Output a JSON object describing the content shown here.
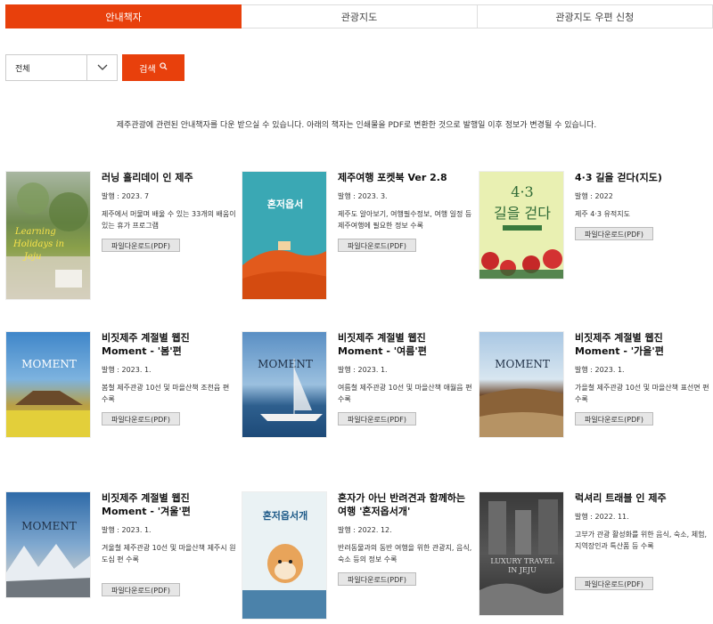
{
  "tabs": [
    {
      "label": "안내책자",
      "active": true
    },
    {
      "label": "관광지도",
      "active": false
    },
    {
      "label": "관광지도 우편 신청",
      "active": false
    }
  ],
  "filter": {
    "select_value": "전체",
    "search_label": "검색"
  },
  "notice": "제주관광에 관련된 안내책자를 다운 받으실 수 있습니다. 아래의 책자는 인쇄물을 PDF로 변환한 것으로 발행일 이후 정보가 변경될 수 있습니다.",
  "download_label": "파일다운로드(PDF)",
  "books": [
    {
      "title": "러닝 홀리데이 인 제주",
      "date": "발행 : 2023. 7",
      "desc": "제주에서 머물며 배울 수 있는 33개의 배움이 있는 휴가 프로그램",
      "cover_text": "Learning Holidays in Jeju"
    },
    {
      "title": "제주여행 포켓북 Ver 2.8",
      "date": "발행 : 2023. 3.",
      "desc": "제주도 알아보기, 여행필수정보, 여행 일정 등 제주여행에 필요한 정보 수록",
      "cover_text": "혼저옵서"
    },
    {
      "title": "4·3 길을 걷다(지도)",
      "date": "발행 : 2022",
      "desc": "제주 4·3 유적지도",
      "cover_text": "4·3 길을 걷다"
    },
    {
      "title": "비짓제주 계절별 웹진 Moment - '봄'편",
      "date": "발행 : 2023. 1.",
      "desc": "봄철 제주관광 10선 및 마을산책 조천읍 편 수록",
      "cover_text": "MOMENT"
    },
    {
      "title": "비짓제주 계절별 웹진 Moment - '여름'편",
      "date": "발행 : 2023. 1.",
      "desc": "여름철 제주관광 10선 및 마을산책 애월읍 편 수록",
      "cover_text": "MOMENT"
    },
    {
      "title": "비짓제주 계절별 웹진 Moment - '가을'편",
      "date": "발행 : 2023. 1.",
      "desc": "가을철 제주관광 10선 및 마을산책 표선면 편 수록",
      "cover_text": "MOMENT"
    },
    {
      "title": "비짓제주 계절별 웹진 Moment - '겨울'편",
      "date": "발행 : 2023. 1.",
      "desc": "겨울철 제주관광 10선 및 마을산책 제주시 원도심 편 수록",
      "cover_text": "MOMENT"
    },
    {
      "title": "혼자가 아닌 반려견과 함께하는 여행 '혼저옵서개'",
      "date": "발행 : 2022. 12.",
      "desc": "반려동물과의 동반 여행을 위한 관광지, 음식, 숙소 등의 정보 수록",
      "cover_text": "혼저옵서개"
    },
    {
      "title": "럭셔리 트래블 인 제주",
      "date": "발행 : 2022. 11.",
      "desc": "고부가 관광 활성화를 위한 음식, 숙소, 체험, 지역장인과 특산품 등 수록",
      "cover_text": "LUXURY TRAVEL IN JEJU"
    }
  ],
  "colors": {
    "accent": "#e8400c"
  }
}
